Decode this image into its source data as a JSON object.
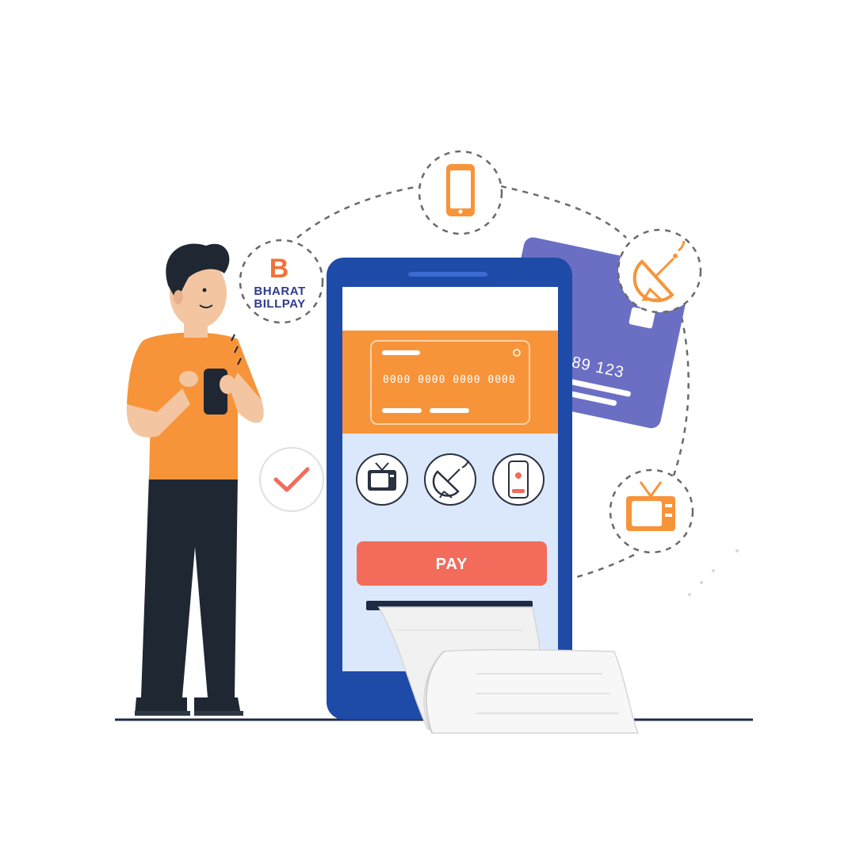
{
  "logo": {
    "letter": "B",
    "line1": "BHARAT",
    "line2": "BILLPAY"
  },
  "phone": {
    "card_number": "0000 0000 0000 0000",
    "pay_label": "PAY",
    "service_icons": [
      "tv-icon",
      "satellite-dish-icon",
      "mobile-phone-icon"
    ]
  },
  "purple_card": {
    "number": "789 123"
  },
  "orbit_icons": [
    "bharat-billpay-logo",
    "mobile-phone-icon",
    "satellite-dish-icon",
    "tv-icon",
    "checkmark-icon"
  ],
  "colors": {
    "orange": "#f7943a",
    "navy": "#1e4aa8",
    "coral": "#f26b5b",
    "purple": "#6b6fc4",
    "light_blue": "#dbe8fb",
    "dark": "#1f2733"
  }
}
